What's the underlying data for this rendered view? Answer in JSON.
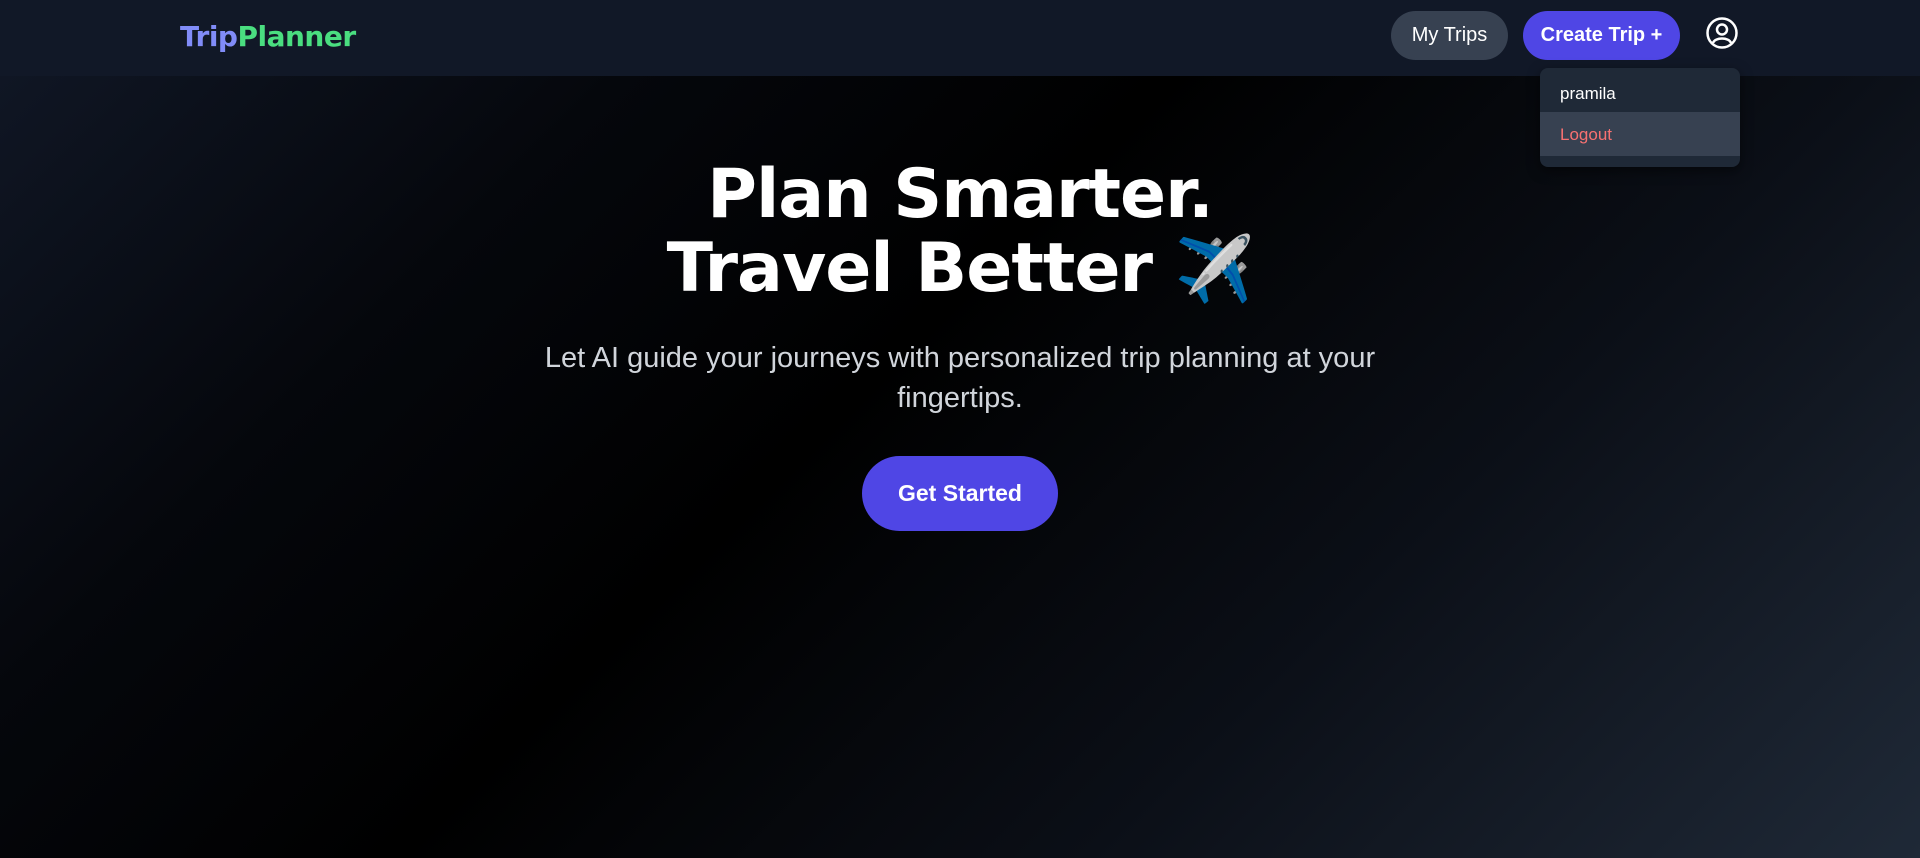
{
  "nav": {
    "logo_part1": "Trip",
    "logo_part2": "Planner",
    "my_trips_label": "My Trips",
    "create_trip_label": "Create Trip +",
    "profile_icon": "user-circle-icon"
  },
  "dropdown": {
    "username": "pramila",
    "logout_label": "Logout"
  },
  "hero": {
    "title_line1": "Plan Smarter.",
    "title_line2": "Travel Better",
    "title_emoji": "✈️",
    "subtitle": "Let AI guide your journeys with personalized trip planning at your fingertips.",
    "cta_label": "Get Started"
  },
  "colors": {
    "accent": "#4f46e5",
    "logo_trip": "#818cf8",
    "logo_planner": "#4ade80",
    "logout": "#f87171"
  }
}
